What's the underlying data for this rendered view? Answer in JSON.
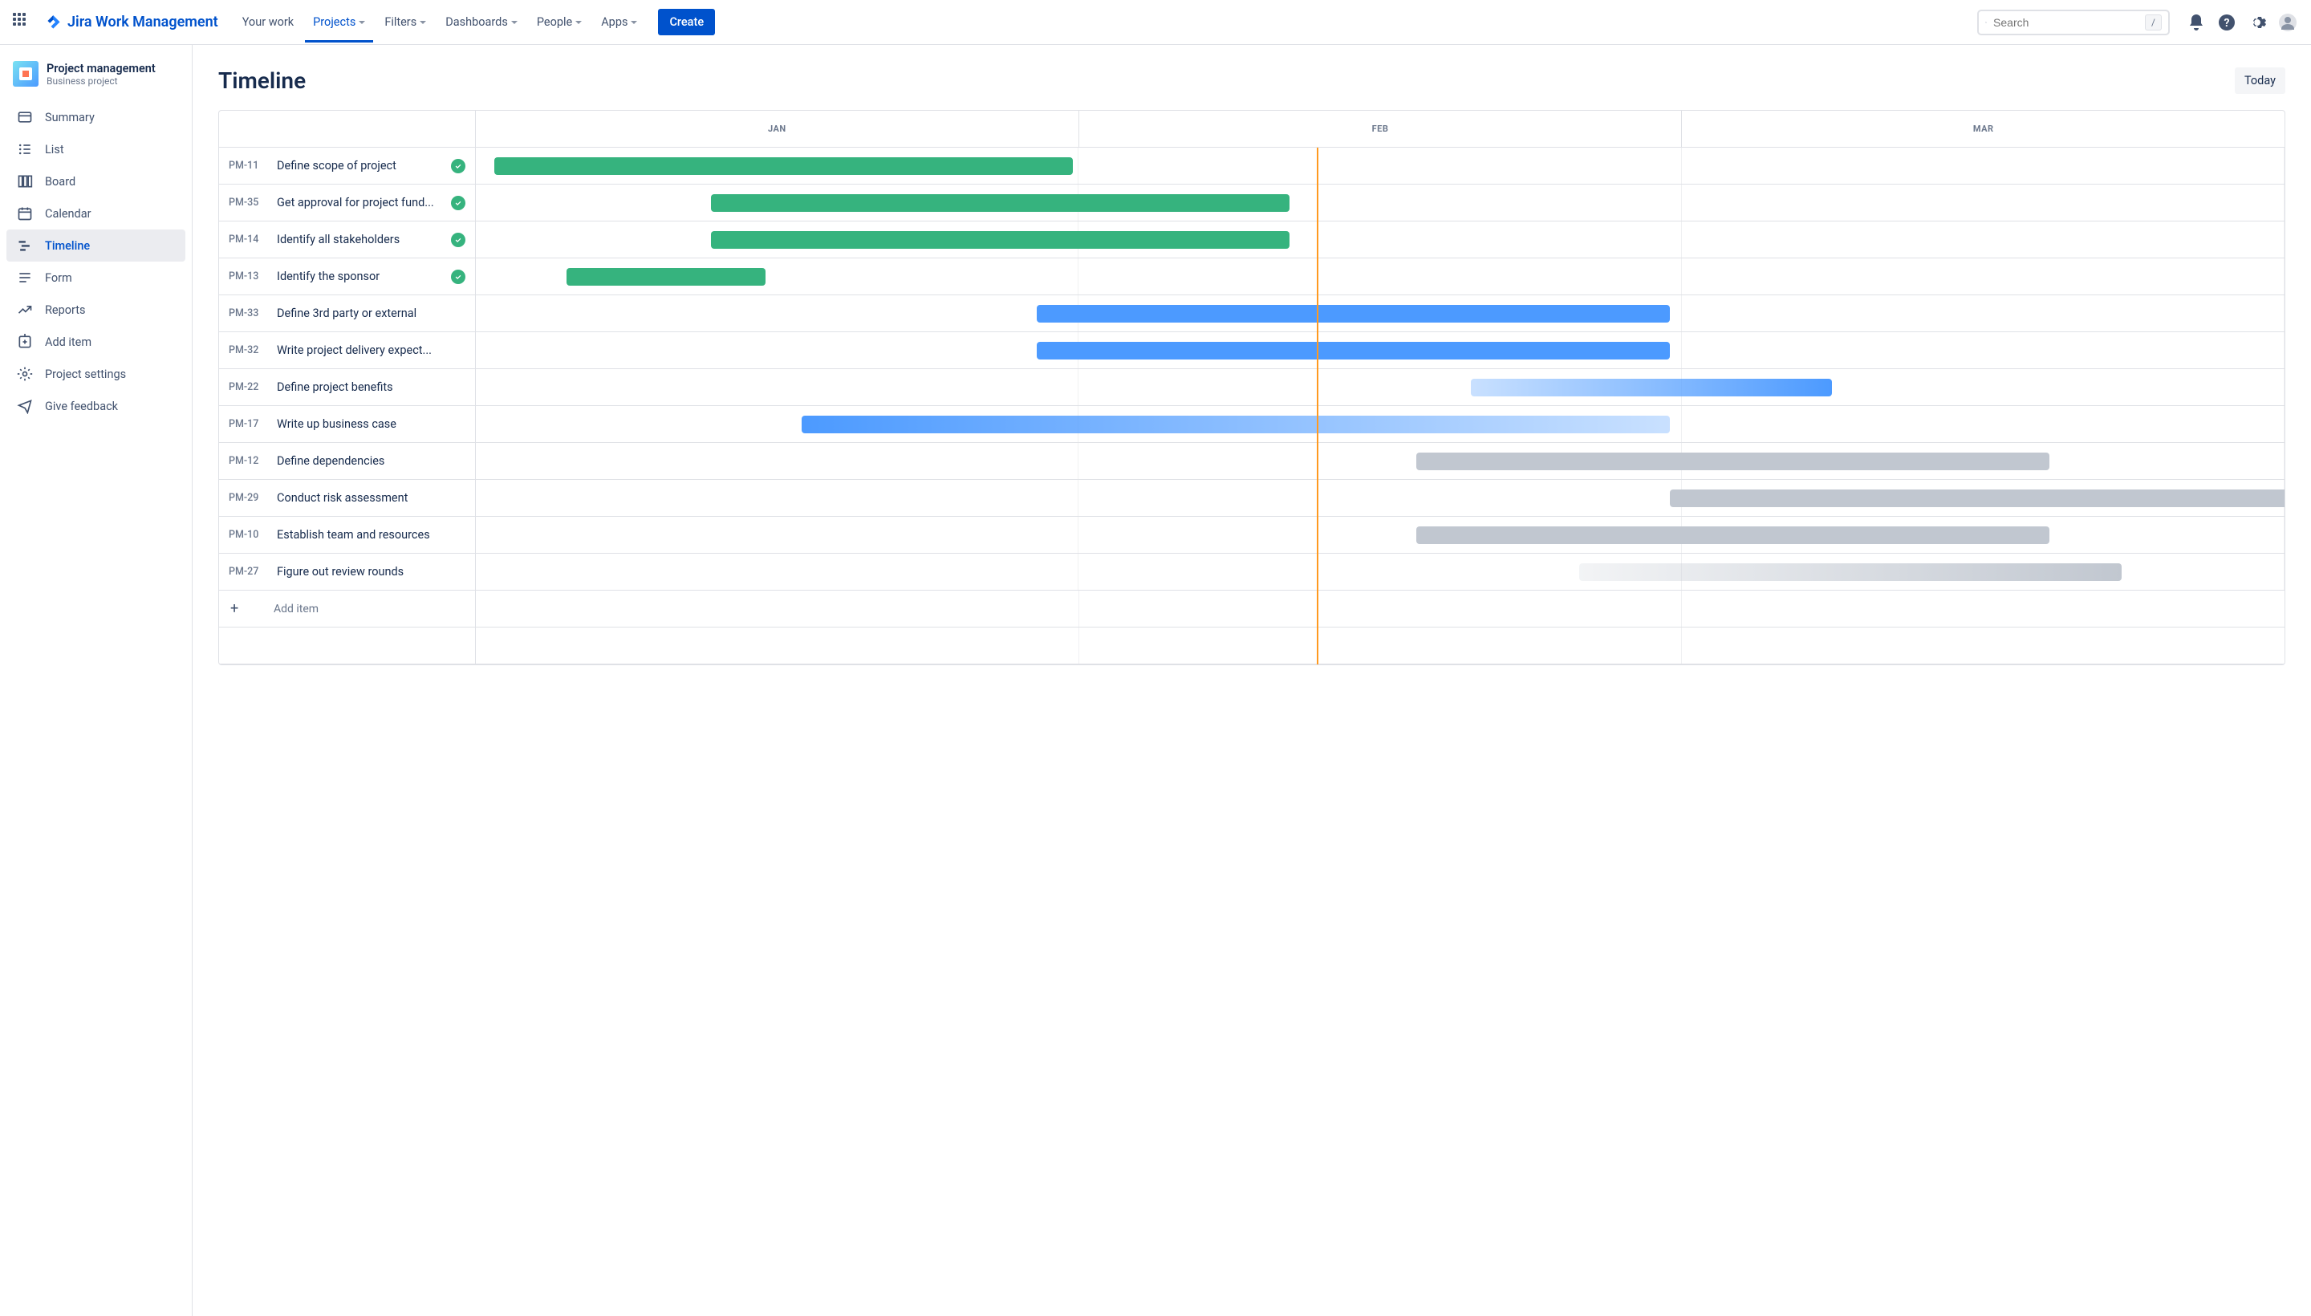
{
  "nav": {
    "product": "Jira Work Management",
    "items": [
      {
        "label": "Your work",
        "dropdown": false,
        "active": false
      },
      {
        "label": "Projects",
        "dropdown": true,
        "active": true
      },
      {
        "label": "Filters",
        "dropdown": true,
        "active": false
      },
      {
        "label": "Dashboards",
        "dropdown": true,
        "active": false
      },
      {
        "label": "People",
        "dropdown": true,
        "active": false
      },
      {
        "label": "Apps",
        "dropdown": true,
        "active": false
      }
    ],
    "create": "Create",
    "search_placeholder": "Search",
    "search_shortcut": "/"
  },
  "project": {
    "name": "Project management",
    "type": "Business project"
  },
  "sidebar": {
    "items": [
      {
        "label": "Summary",
        "icon": "summary-icon"
      },
      {
        "label": "List",
        "icon": "list-icon"
      },
      {
        "label": "Board",
        "icon": "board-icon"
      },
      {
        "label": "Calendar",
        "icon": "calendar-icon"
      },
      {
        "label": "Timeline",
        "icon": "timeline-icon",
        "active": true
      },
      {
        "label": "Form",
        "icon": "form-icon"
      },
      {
        "label": "Reports",
        "icon": "reports-icon"
      },
      {
        "label": "Add item",
        "icon": "add-item-icon"
      },
      {
        "label": "Project settings",
        "icon": "settings-icon"
      },
      {
        "label": "Give feedback",
        "icon": "feedback-icon"
      }
    ]
  },
  "page": {
    "title": "Timeline",
    "today": "Today",
    "months": [
      "JAN",
      "FEB",
      "MAR"
    ],
    "today_position_pct": 46.5,
    "add_item": "Add item"
  },
  "tasks": [
    {
      "id": "PM-11",
      "name": "Define scope of project",
      "done": true,
      "bar": {
        "start": 1,
        "width": 32,
        "color": "green"
      }
    },
    {
      "id": "PM-35",
      "name": "Get approval for project fund...",
      "done": true,
      "bar": {
        "start": 13,
        "width": 32,
        "color": "green"
      }
    },
    {
      "id": "PM-14",
      "name": "Identify all stakeholders",
      "done": true,
      "bar": {
        "start": 13,
        "width": 32,
        "color": "green"
      }
    },
    {
      "id": "PM-13",
      "name": "Identify the sponsor",
      "done": true,
      "bar": {
        "start": 5,
        "width": 11,
        "color": "green"
      }
    },
    {
      "id": "PM-33",
      "name": "Define 3rd party or external",
      "done": false,
      "bar": {
        "start": 31,
        "width": 35,
        "color": "blue"
      }
    },
    {
      "id": "PM-32",
      "name": "Write project delivery expect...",
      "done": false,
      "bar": {
        "start": 31,
        "width": 35,
        "color": "blue"
      }
    },
    {
      "id": "PM-22",
      "name": "Define project benefits",
      "done": false,
      "bar": {
        "start": 55,
        "width": 20,
        "color": "blue-fade"
      }
    },
    {
      "id": "PM-17",
      "name": "Write up business case",
      "done": false,
      "bar": {
        "start": 18,
        "width": 48,
        "color": "blue-fade-r"
      }
    },
    {
      "id": "PM-12",
      "name": "Define dependencies",
      "done": false,
      "bar": {
        "start": 52,
        "width": 35,
        "color": "grey"
      }
    },
    {
      "id": "PM-29",
      "name": "Conduct risk assessment",
      "done": false,
      "bar": {
        "start": 66,
        "width": 35,
        "color": "grey"
      }
    },
    {
      "id": "PM-10",
      "name": "Establish team and resources",
      "done": false,
      "bar": {
        "start": 52,
        "width": 35,
        "color": "grey"
      }
    },
    {
      "id": "PM-27",
      "name": "Figure out review rounds",
      "done": false,
      "bar": {
        "start": 61,
        "width": 30,
        "color": "grey-fade"
      }
    }
  ]
}
